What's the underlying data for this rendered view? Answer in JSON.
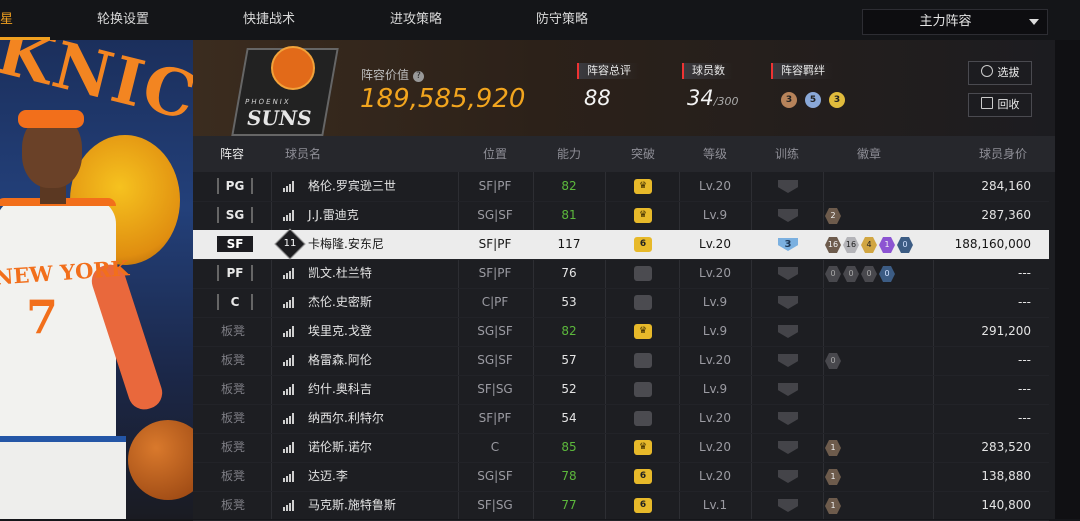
{
  "nav": {
    "first_tab_partial": "星",
    "tabs": [
      "轮换设置",
      "快捷战术",
      "进攻策略",
      "防守策略"
    ],
    "roster_dropdown": "主力阵容"
  },
  "left_art": {
    "bg_text": "KNICKS",
    "jersey_text": "NEW YORK",
    "jersey_number": "7"
  },
  "summary": {
    "team_logo_top": "PHOENIX",
    "team_logo_word": "SUNS",
    "lineup_value_label": "阵容价值",
    "lineup_value": "189,585,920",
    "overall_label": "阵容总评",
    "overall_value": "88",
    "player_count_label": "球员数",
    "player_count_value": "34",
    "player_count_max": "/300",
    "bond_label": "阵容羁绊",
    "bond_icons": [
      {
        "color": "#b7835a",
        "num": "3"
      },
      {
        "color": "#8aa8d8",
        "num": "5"
      },
      {
        "color": "#e0bb3c",
        "num": "3"
      }
    ],
    "select_button": "选拔",
    "recycle_button": "回收"
  },
  "table": {
    "headers": [
      "阵容",
      "球员名",
      "位置",
      "能力",
      "突破",
      "等级",
      "训练",
      "徽章",
      "球员身价"
    ],
    "rows": [
      {
        "slot": "PG",
        "type": "starter",
        "name": "格伦.罗宾逊三世",
        "position": "SF|PF",
        "ability": "82",
        "ability_green": true,
        "break": "crown",
        "level": "Lv.20",
        "train": "",
        "badges": [],
        "value": "284,160"
      },
      {
        "slot": "SG",
        "type": "starter",
        "name": "J.J.雷迪克",
        "position": "SG|SF",
        "ability": "81",
        "ability_green": true,
        "break": "crown",
        "level": "Lv.9",
        "train": "",
        "badges": [
          {
            "t": "2",
            "c": "bronze"
          }
        ],
        "value": "287,360"
      },
      {
        "slot": "SF",
        "type": "selected",
        "rank": "11",
        "name": "卡梅隆.安东尼",
        "position": "SF|PF",
        "ability": "117",
        "ability_green": false,
        "break": "6",
        "level": "Lv.20",
        "train": "3",
        "badges": [
          {
            "t": "16",
            "c": "bronze"
          },
          {
            "t": "16",
            "c": "silver"
          },
          {
            "t": "4",
            "c": "gold"
          },
          {
            "t": "1",
            "c": "purple"
          },
          {
            "t": "0",
            "c": "blue"
          }
        ],
        "value": "188,160,000"
      },
      {
        "slot": "PF",
        "type": "starter",
        "name": "凯文.杜兰特",
        "position": "SF|PF",
        "ability": "76",
        "ability_green": false,
        "break": "gray",
        "level": "Lv.20",
        "train": "",
        "badges": [
          {
            "t": "0",
            "c": "gray"
          },
          {
            "t": "0",
            "c": "gray"
          },
          {
            "t": "0",
            "c": "gray"
          },
          {
            "t": "0",
            "c": "blue"
          }
        ],
        "value": "---"
      },
      {
        "slot": "C",
        "type": "starter",
        "name": "杰伦.史密斯",
        "position": "C|PF",
        "ability": "53",
        "ability_green": false,
        "break": "gray",
        "level": "Lv.9",
        "train": "",
        "badges": [],
        "value": "---"
      },
      {
        "slot": "板凳",
        "type": "bench",
        "name": "埃里克.戈登",
        "position": "SG|SF",
        "ability": "82",
        "ability_green": true,
        "break": "crown",
        "level": "Lv.9",
        "train": "",
        "badges": [],
        "value": "291,200"
      },
      {
        "slot": "板凳",
        "type": "bench",
        "name": "格雷森.阿伦",
        "position": "SG|SF",
        "ability": "57",
        "ability_green": false,
        "break": "gray",
        "level": "Lv.20",
        "train": "",
        "badges": [
          {
            "t": "0",
            "c": "gray"
          }
        ],
        "value": "---"
      },
      {
        "slot": "板凳",
        "type": "bench",
        "name": "约什.奥科吉",
        "position": "SF|SG",
        "ability": "52",
        "ability_green": false,
        "break": "gray",
        "level": "Lv.9",
        "train": "",
        "badges": [],
        "value": "---"
      },
      {
        "slot": "板凳",
        "type": "bench",
        "name": "纳西尔.利特尔",
        "position": "SF|PF",
        "ability": "54",
        "ability_green": false,
        "break": "gray",
        "level": "Lv.20",
        "train": "",
        "badges": [],
        "value": "---"
      },
      {
        "slot": "板凳",
        "type": "bench",
        "name": "诺伦斯.诺尔",
        "position": "C",
        "ability": "85",
        "ability_green": true,
        "break": "crown",
        "level": "Lv.20",
        "train": "",
        "badges": [
          {
            "t": "1",
            "c": "bronze"
          }
        ],
        "value": "283,520"
      },
      {
        "slot": "板凳",
        "type": "bench",
        "name": "达迈.李",
        "position": "SG|SF",
        "ability": "78",
        "ability_green": true,
        "break": "6",
        "level": "Lv.20",
        "train": "",
        "badges": [
          {
            "t": "1",
            "c": "bronze"
          }
        ],
        "value": "138,880"
      },
      {
        "slot": "板凳",
        "type": "bench",
        "name": "马克斯.施特鲁斯",
        "position": "SF|SG",
        "ability": "77",
        "ability_green": true,
        "break": "6",
        "level": "Lv.1",
        "train": "",
        "badges": [
          {
            "t": "1",
            "c": "bronze"
          }
        ],
        "value": "140,800"
      }
    ]
  }
}
